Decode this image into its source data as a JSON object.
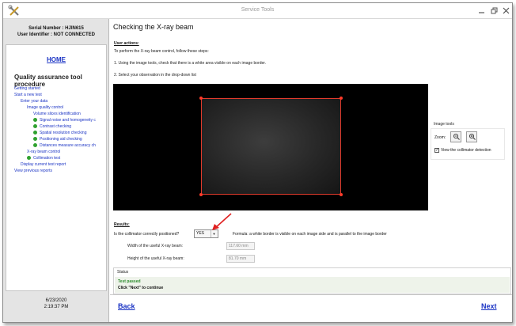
{
  "window": {
    "title": "Service Tools",
    "minimize_icon": "minimize-icon",
    "restore_icon": "restore-icon",
    "close_icon": "close-icon"
  },
  "sidebar": {
    "serial_number": "Serial Number : HJIN615",
    "user_identifier": "User Identifier : NOT CONNECTED",
    "home": "HOME",
    "procedure_title": "Quality assurance tool procedure",
    "items": [
      {
        "label": "Getting started",
        "level": 0,
        "done": false
      },
      {
        "label": "Start a new test",
        "level": 0,
        "done": false
      },
      {
        "label": "Enter your data",
        "level": 1,
        "done": false
      },
      {
        "label": "Image quality control",
        "level": 2,
        "done": false
      },
      {
        "label": "Volume slices identification",
        "level": 3,
        "done": false
      },
      {
        "label": "Signal noise and homogeneity c",
        "level": 4,
        "done": true
      },
      {
        "label": "Contrast checking",
        "level": 4,
        "done": true
      },
      {
        "label": "Spatial resolution checking",
        "level": 4,
        "done": true
      },
      {
        "label": "Positioning aid checking",
        "level": 4,
        "done": true
      },
      {
        "label": "Distances measure accuracy ch",
        "level": 4,
        "done": true
      },
      {
        "label": "X-ray beam control",
        "level": 2,
        "done": false
      },
      {
        "label": "Collimation test",
        "level": 3,
        "done": true
      },
      {
        "label": "Display current test report",
        "level": 1,
        "done": false
      },
      {
        "label": "View previous reports",
        "level": 0,
        "done": false
      }
    ],
    "date": "6/23/2020",
    "time": "2:19:37 PM"
  },
  "main": {
    "title": "Checking the X-ray beam",
    "user_actions_head": "User actions:",
    "intro": "To perform the X-ray beam control, follow these steps:",
    "step1": "1. Using the image tools, check that there is a white area visible on each image border.",
    "step2": "2. Select your observation in the drop-down list",
    "image_tools": {
      "title": "Image tools",
      "zoom_label": "Zoom:",
      "zoom_out_icon": "zoom-out-icon",
      "zoom_in_icon": "zoom-in-icon",
      "collimator_checked": true,
      "collimator_label": "View the collimator detection"
    },
    "results_head": "Results:",
    "question": "Is the collimator correctly positioned?",
    "answer": "YES",
    "formula": "Formula:  a white border is visible on each image side and is parallel to the image border",
    "width_label": "Width of the useful X-ray beam:",
    "width_value": "117.60 mm",
    "height_label": "Height of the useful X-ray beam:",
    "height_value": "81.70 mm",
    "status_head": "Status",
    "status_line1": "Test passed",
    "status_line2": "Click \"Next\" to continue"
  },
  "footer": {
    "back": "Back",
    "next": "Next"
  },
  "colors": {
    "link_blue": "#1a33c4",
    "pass_green": "#2a8a2a",
    "beam_border_red": "#e03a2c",
    "done_dot_green": "#2fa12f"
  }
}
